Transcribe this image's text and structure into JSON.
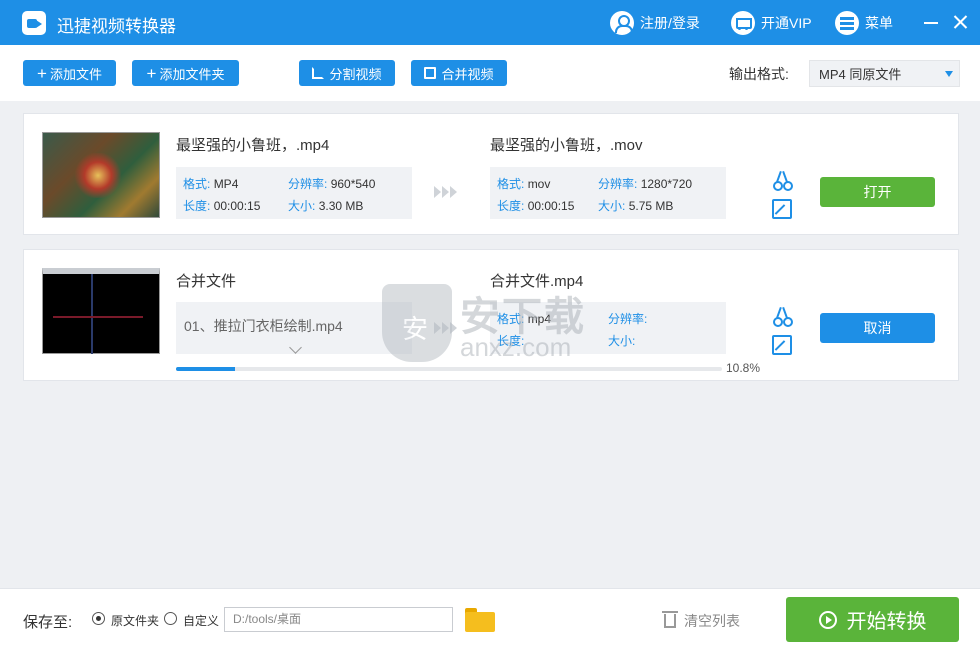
{
  "app": {
    "title": "迅捷视频转换器"
  },
  "titlebar": {
    "login_label": "注册/登录",
    "vip_label": "开通VIP",
    "menu_label": "菜单"
  },
  "toolbar": {
    "add_file_label": "添加文件",
    "add_folder_label": "添加文件夹",
    "split_label": "分割视频",
    "merge_label": "合并视频",
    "output_format_label": "输出格式:",
    "output_format_value": "MP4  同原文件"
  },
  "items": [
    {
      "source_name": "最坚强的小鲁班，.mp4",
      "source": {
        "format_key": "格式:",
        "format": "MP4",
        "resolution_key": "分辨率:",
        "resolution": "960*540",
        "duration_key": "长度:",
        "duration": "00:00:15",
        "size_key": "大小:",
        "size": "3.30 MB"
      },
      "target_name": "最坚强的小鲁班，.mov",
      "target": {
        "format_key": "格式:",
        "format": "mov",
        "resolution_key": "分辨率:",
        "resolution": "1280*720",
        "duration_key": "长度:",
        "duration": "00:00:15",
        "size_key": "大小:",
        "size": "5.75 MB"
      },
      "action_label": "打开"
    },
    {
      "source_name": "合并文件",
      "merge_file": "01、推拉门衣柜绘制.mp4",
      "target_name": "合并文件.mp4",
      "target": {
        "format_key": "格式:",
        "format": "mp4",
        "resolution_key": "分辨率:",
        "resolution": "",
        "duration_key": "长度:",
        "duration": "",
        "size_key": "大小:",
        "size": ""
      },
      "action_label": "取消",
      "progress": 0.108,
      "progress_text": "10.8%"
    }
  ],
  "watermark": {
    "text": "安下载",
    "sub": "anxz.com",
    "shield": "安"
  },
  "bottom": {
    "save_label": "保存至:",
    "option_original": "原文件夹",
    "option_custom": "自定义",
    "path_placeholder": "D:/tools/桌面",
    "clear_label": "清空列表",
    "start_label": "开始转换"
  }
}
